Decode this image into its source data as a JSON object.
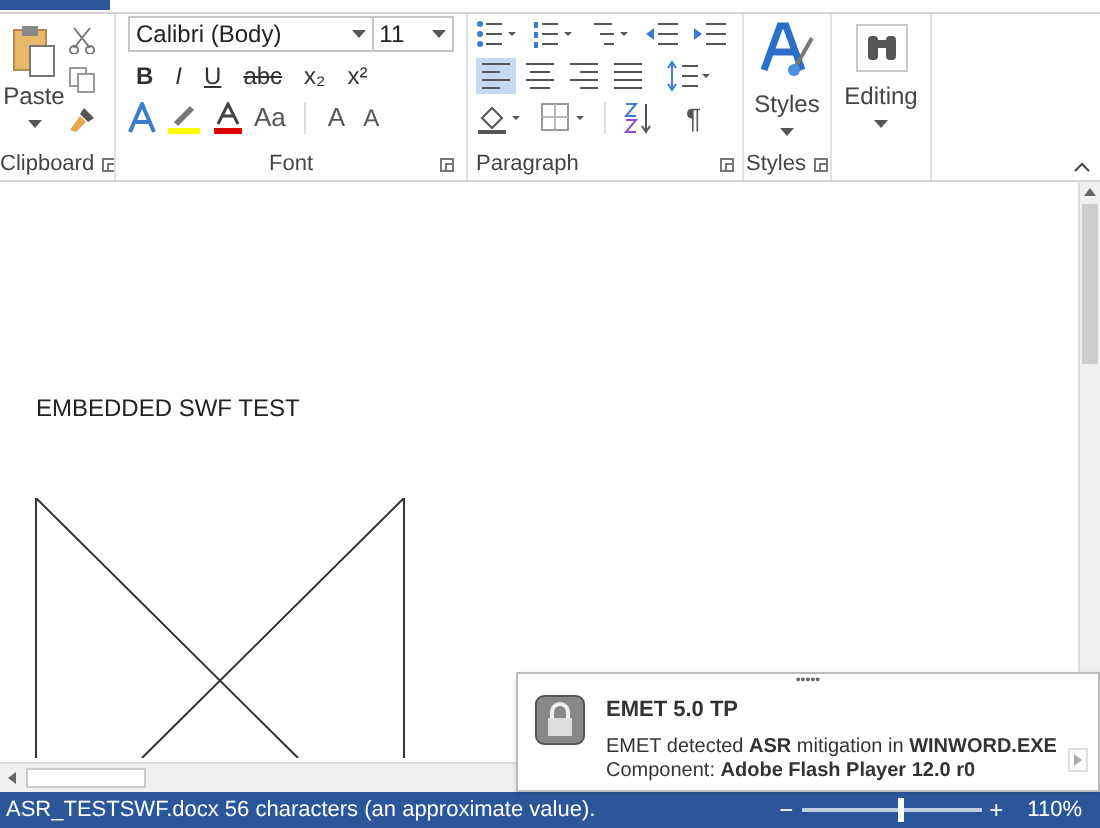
{
  "ribbon": {
    "clipboard": {
      "paste": "Paste",
      "label": "Clipboard"
    },
    "font": {
      "name": "Calibri (Body)",
      "size": "11",
      "format_buttons": [
        "B",
        "I",
        "U",
        "abc",
        "x₂",
        "x²"
      ],
      "change_case": "Aa",
      "grow": "A",
      "shrink": "A",
      "label": "Font"
    },
    "paragraph": {
      "alignments": [
        {
          "selected": true
        },
        {
          "selected": false
        },
        {
          "selected": false
        },
        {
          "selected": false
        }
      ],
      "pilcrow": "¶",
      "label": "Paragraph"
    },
    "styles": {
      "button": "Styles",
      "label": "Styles"
    },
    "editing": {
      "button": "Editing"
    }
  },
  "document": {
    "heading": "EMBEDDED SWF TEST"
  },
  "status_bar": {
    "text": "ASR_TESTSWF.docx 56 characters (an approximate value).",
    "zoom_out": "−",
    "zoom_in": "+",
    "zoom_slider": {
      "level": 0.55
    },
    "zoom": "110%"
  },
  "notification": {
    "handle": "•••••",
    "title": "EMET 5.0 TP",
    "message": "EMET detected **ASR** mitigation in **WINWORD.EXE**",
    "component": "Component: **Adobe Flash Player 12.0 r0**"
  }
}
